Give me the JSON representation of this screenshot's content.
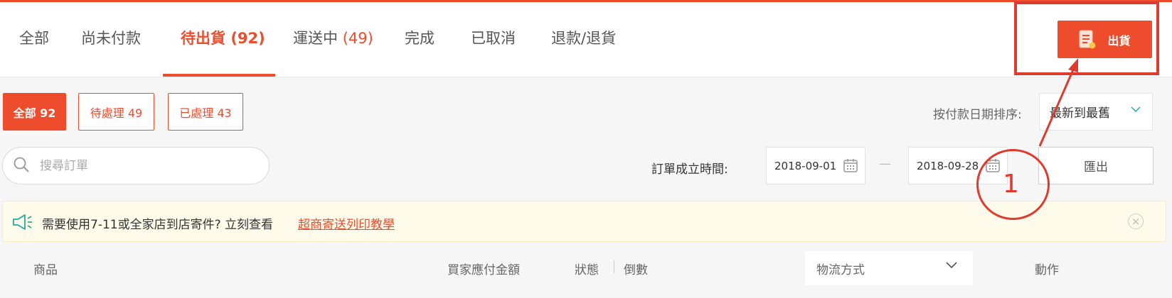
{
  "tabs": [
    {
      "label": "全部",
      "count": ""
    },
    {
      "label": "尚未付款",
      "count": ""
    },
    {
      "label": "待出貨",
      "count": "(92)"
    },
    {
      "label": "運送中",
      "count": "(49)"
    },
    {
      "label": "完成",
      "count": ""
    },
    {
      "label": "已取消",
      "count": ""
    },
    {
      "label": "退款/退貨",
      "count": ""
    }
  ],
  "active_tab": "待出貨",
  "ship_button": {
    "label": "出貨"
  },
  "filters": [
    {
      "label": "全部 92",
      "active": true
    },
    {
      "label": "待處理 49",
      "active": false
    },
    {
      "label": "已處理 43",
      "active": false
    }
  ],
  "sort": {
    "label": "按付款日期排序:",
    "value": "最新到最舊"
  },
  "search": {
    "placeholder": "搜尋訂單",
    "value": ""
  },
  "date_filter": {
    "label": "訂單成立時間:",
    "from": "2018-09-01",
    "separator": "—",
    "to": "2018-09-28"
  },
  "export_button": {
    "label": "匯出"
  },
  "annotation": {
    "number": "1"
  },
  "notice": {
    "text": "需要使用7-11或全家店到店寄件? 立刻查看",
    "link": "超商寄送列印教學"
  },
  "table_header": {
    "product": "商品",
    "amount": "買家應付金額",
    "status": "狀態",
    "countdown": "倒數",
    "logistics": "物流方式",
    "action": "動作"
  },
  "colors": {
    "accent": "#ee4d2d",
    "annotation": "#e03a2e",
    "notice_bg": "#fffbea",
    "teal": "#26aa99"
  }
}
